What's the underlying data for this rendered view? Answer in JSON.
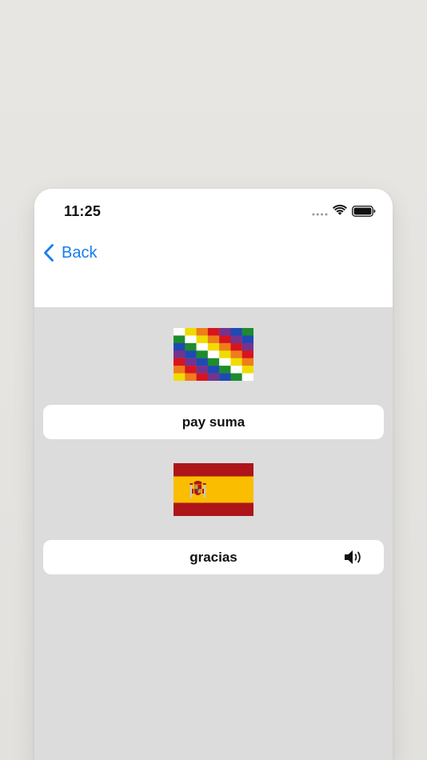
{
  "status_bar": {
    "time": "11:25",
    "icons": [
      "cellular-signal-icon",
      "wifi-icon",
      "battery-icon"
    ]
  },
  "nav": {
    "back_label": "Back",
    "back_icon": "chevron-left-icon"
  },
  "cards": [
    {
      "flag": "wiphala-flag",
      "phrase": "pay suma",
      "has_audio": false
    },
    {
      "flag": "spain-flag",
      "phrase": "gracias",
      "has_audio": true,
      "audio_icon": "speaker-icon"
    }
  ],
  "colors": {
    "accent": "#1a7cf0",
    "background": "#dcdcdc",
    "card": "#ffffff",
    "outer_background": "#e6e4e1"
  }
}
